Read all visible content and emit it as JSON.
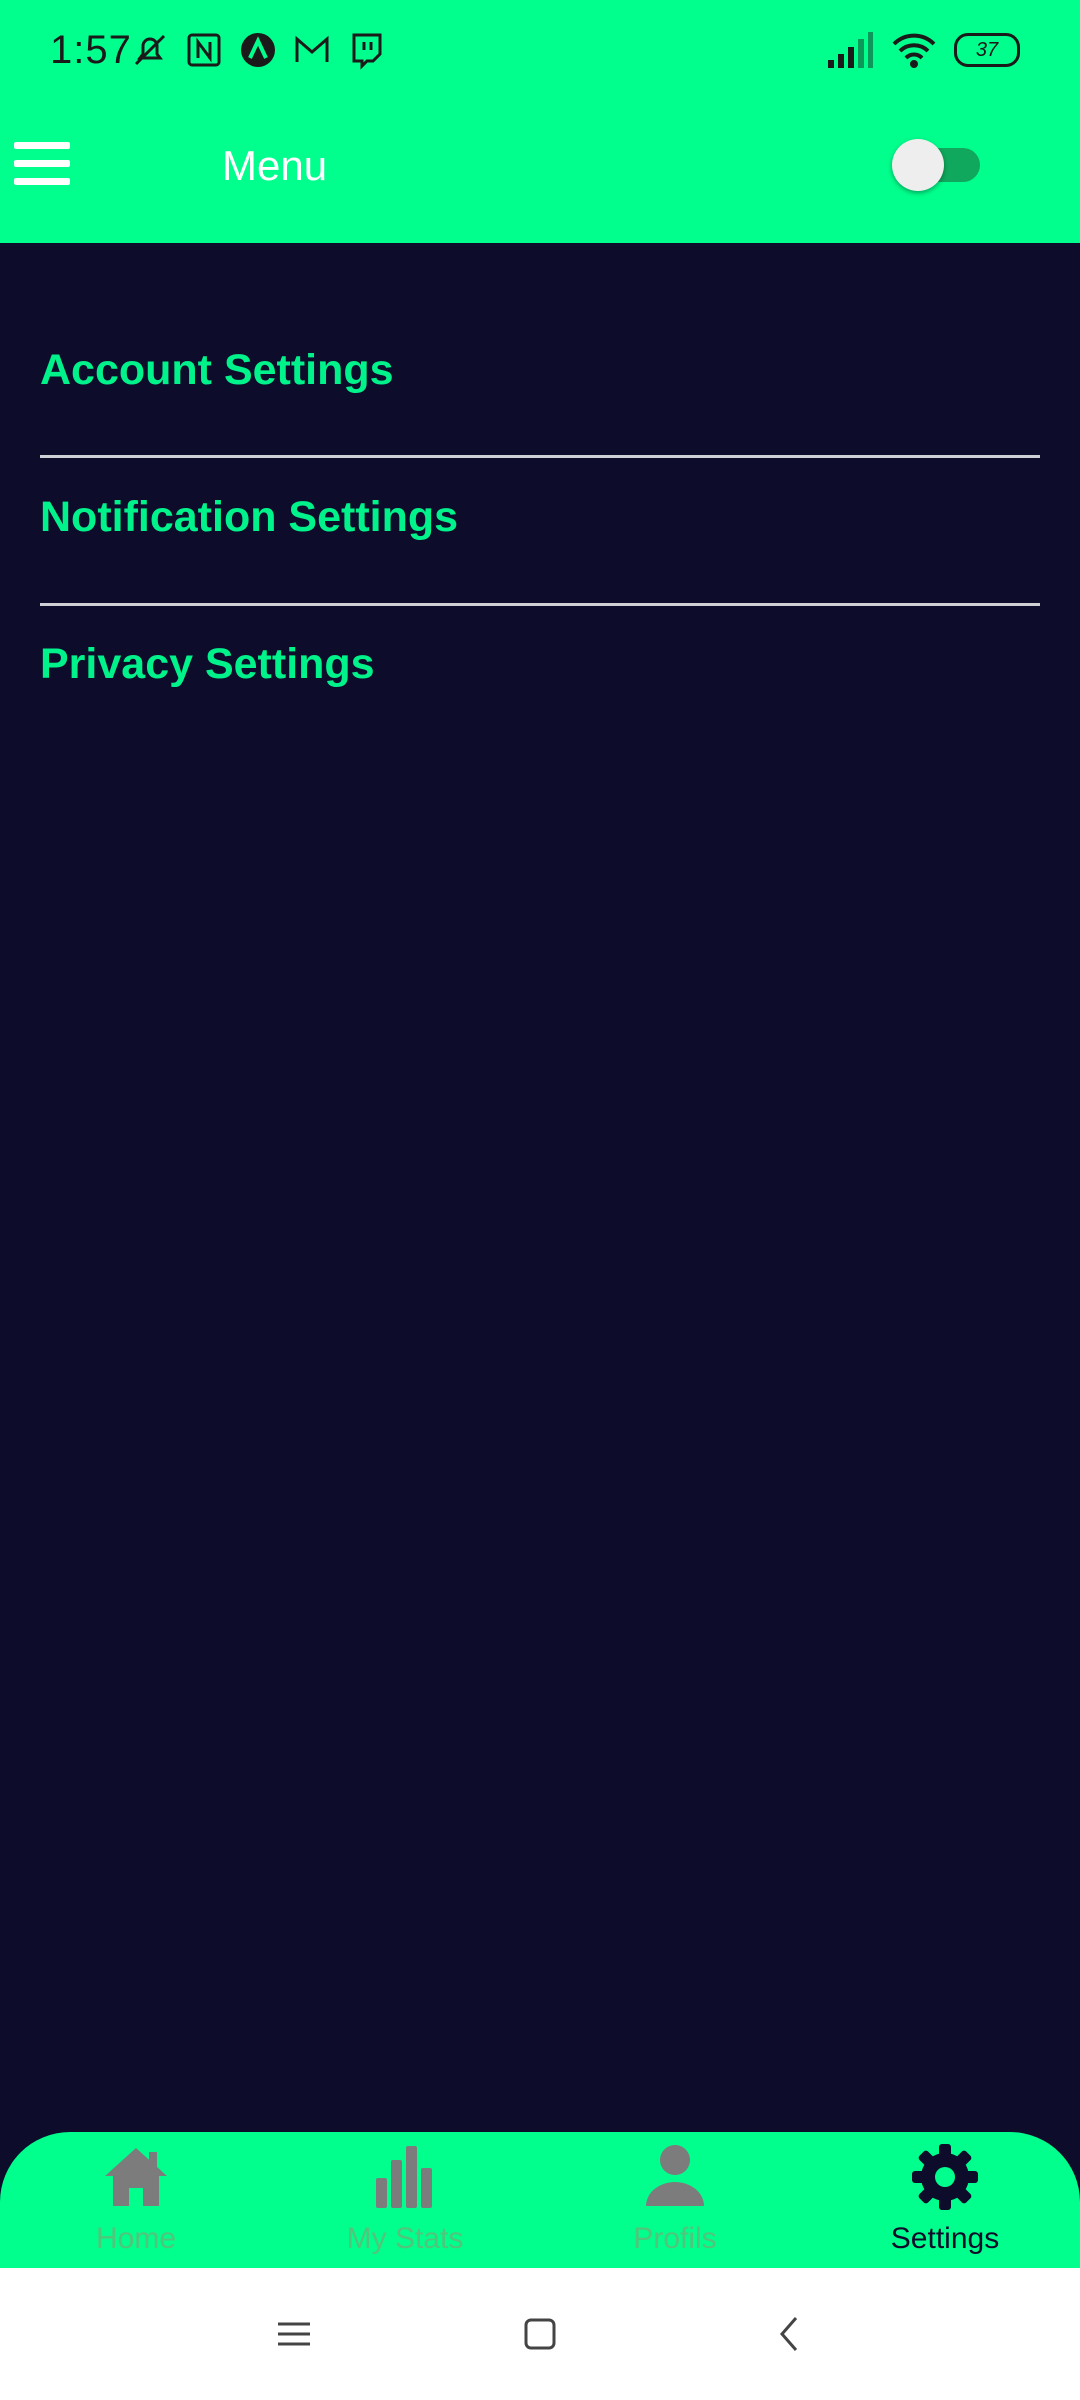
{
  "status_bar": {
    "time": "1:57",
    "battery": "37",
    "left_icons": [
      "muted-bell-icon",
      "nfc-icon",
      "app-a-icon",
      "gmail-icon",
      "twitch-icon"
    ],
    "right_icons": [
      "signal-icon",
      "wifi-icon",
      "battery-icon"
    ]
  },
  "header": {
    "title": "Menu",
    "menu_icon": "hamburger-icon",
    "toggle_on": false,
    "background_color": "#00FF8C"
  },
  "settings": {
    "items": [
      {
        "label": "Account Settings"
      },
      {
        "label": "Notification Settings"
      },
      {
        "label": "Privacy Settings"
      }
    ],
    "text_color": "#00F28A",
    "background_color": "#0D0D2B"
  },
  "bottom_nav": {
    "items": [
      {
        "label": "Home",
        "icon": "home-icon",
        "active": false
      },
      {
        "label": "My Stats",
        "icon": "bar-chart-icon",
        "active": false
      },
      {
        "label": "Profils",
        "icon": "person-icon",
        "active": false
      },
      {
        "label": "Settings",
        "icon": "gear-icon",
        "active": true
      }
    ]
  },
  "system_nav": {
    "icons": [
      "recents-icon",
      "home-square-icon",
      "back-icon"
    ]
  }
}
